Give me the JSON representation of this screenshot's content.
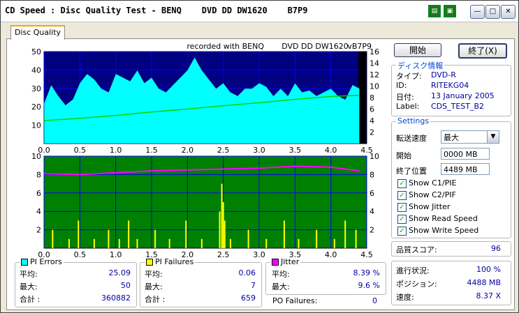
{
  "window": {
    "title": "CD Speed : Disc Quality Test - BENQ    DVD DD DW1620    B7P9",
    "icons": [
      "copy-icon",
      "save-icon"
    ]
  },
  "tab": {
    "label": "Disc Quality"
  },
  "chart_header": {
    "recorded": "recorded with BENQ",
    "drive": "DVD DD DW1620",
    "version": "vB7P9"
  },
  "buttons": {
    "start": "開始",
    "exit": "終了(X)"
  },
  "disc_info": {
    "title": "ディスク情報",
    "rows": [
      {
        "k": "タイプ:",
        "v": "DVD-R"
      },
      {
        "k": "ID:",
        "v": "RITEKG04"
      },
      {
        "k": "日付:",
        "v": "13 January 2005"
      },
      {
        "k": "Label:",
        "v": "CDS_TEST_B2"
      }
    ]
  },
  "settings": {
    "title": "Settings",
    "speed_label": "転送速度",
    "speed_value": "最大",
    "start_label": "開始",
    "start_value": "0000 MB",
    "end_label": "終了位置",
    "end_value": "4489 MB",
    "checks": [
      {
        "label": "Show C1/PIE",
        "checked": true
      },
      {
        "label": "Show C2/PIF",
        "checked": true
      },
      {
        "label": "Show Jitter",
        "checked": true
      },
      {
        "label": "Show Read Speed",
        "checked": true
      },
      {
        "label": "Show Write Speed",
        "checked": true
      }
    ]
  },
  "quality": {
    "label": "品質スコア:",
    "value": "96"
  },
  "progress": [
    {
      "k": "進行状況:",
      "v": "100 %"
    },
    {
      "k": "ポジション:",
      "v": "4488 MB"
    },
    {
      "k": "速度:",
      "v": "8.37 X"
    }
  ],
  "pi_errors": {
    "title": "PI Errors",
    "color": "#00ffff",
    "rows": [
      {
        "k": "平均:",
        "v": "25.09"
      },
      {
        "k": "最大:",
        "v": "50"
      },
      {
        "k": "合計 :",
        "v": "360882"
      }
    ]
  },
  "pi_failures": {
    "title": "PI Failures",
    "color": "#ffff00",
    "rows": [
      {
        "k": "平均:",
        "v": "0.06"
      },
      {
        "k": "最大:",
        "v": "7"
      },
      {
        "k": "合計 :",
        "v": "659"
      }
    ]
  },
  "jitter": {
    "title": "Jitter",
    "color": "#ff00ff",
    "rows": [
      {
        "k": "平均:",
        "v": "8.39 %"
      },
      {
        "k": "最大:",
        "v": "9.6 %"
      }
    ]
  },
  "po_failures": {
    "label": "PO Failures:",
    "value": "0"
  },
  "chart_data": [
    {
      "type": "area",
      "series": [
        {
          "name": "PI Errors",
          "color": "#00ffff",
          "x": [
            0,
            0.1,
            0.2,
            0.3,
            0.4,
            0.5,
            0.6,
            0.7,
            0.8,
            0.9,
            1.0,
            1.1,
            1.2,
            1.3,
            1.4,
            1.5,
            1.6,
            1.7,
            1.8,
            1.9,
            2.0,
            2.1,
            2.2,
            2.3,
            2.4,
            2.5,
            2.6,
            2.7,
            2.8,
            2.9,
            3.0,
            3.1,
            3.2,
            3.3,
            3.4,
            3.5,
            3.6,
            3.7,
            3.8,
            3.9,
            4.0,
            4.1,
            4.2,
            4.3,
            4.4
          ],
          "y": [
            22,
            32,
            26,
            21,
            24,
            33,
            38,
            35,
            30,
            28,
            38,
            36,
            34,
            40,
            33,
            36,
            30,
            28,
            32,
            36,
            40,
            47,
            40,
            35,
            30,
            33,
            28,
            26,
            30,
            30,
            33,
            31,
            26,
            30,
            26,
            33,
            28,
            29,
            26,
            28,
            30,
            26,
            24,
            32,
            30
          ]
        },
        {
          "name": "Read Speed",
          "color": "#00d000",
          "x": [
            0,
            0.5,
            1.0,
            1.5,
            2.0,
            2.5,
            3.0,
            3.5,
            4.0,
            4.4
          ],
          "y": [
            4,
            4.4,
            4.9,
            5.5,
            6.0,
            6.6,
            7.1,
            7.7,
            8.2,
            8.4
          ]
        }
      ],
      "xlim": [
        0,
        4.5
      ],
      "ylim": [
        0,
        50
      ],
      "y2lim": [
        0,
        16
      ],
      "xticks": [
        "0.0",
        "0.5",
        "1.0",
        "1.5",
        "2.0",
        "2.5",
        "3.0",
        "3.5",
        "4.0",
        "4.5"
      ],
      "yticks": [
        "10",
        "20",
        "30",
        "40",
        "50"
      ],
      "y2ticks": [
        "2",
        "4",
        "6",
        "8",
        "10",
        "12",
        "14",
        "16"
      ]
    },
    {
      "type": "bar",
      "series": [
        {
          "name": "PI Failures",
          "color": "#ffff00",
          "x": [
            0.12,
            0.35,
            0.48,
            0.7,
            0.9,
            1.05,
            1.18,
            1.3,
            1.55,
            1.75,
            1.98,
            2.2,
            2.45,
            2.48,
            2.5,
            2.52,
            2.6,
            2.85,
            3.1,
            3.35,
            3.55,
            3.8,
            4.05,
            4.2,
            4.35
          ],
          "y": [
            2,
            1,
            3,
            1,
            2,
            1,
            3,
            1,
            2,
            1,
            3,
            1,
            4,
            7,
            5,
            3,
            1,
            2,
            1,
            3,
            1,
            2,
            1,
            3,
            2
          ]
        },
        {
          "name": "Jitter",
          "color": "#ff00ff",
          "x": [
            0,
            0.5,
            1.0,
            1.5,
            2.0,
            2.5,
            3.0,
            3.5,
            4.0,
            4.4
          ],
          "y": [
            8.1,
            8.0,
            8.2,
            8.4,
            8.5,
            8.6,
            8.7,
            8.9,
            8.8,
            8.4
          ]
        }
      ],
      "xlim": [
        0,
        4.5
      ],
      "ylim": [
        0,
        10
      ],
      "xticks": [
        "0.0",
        "0.5",
        "1.0",
        "1.5",
        "2.0",
        "2.5",
        "3.0",
        "3.5",
        "4.0",
        "4.5"
      ],
      "yticks": [
        "2",
        "4",
        "6",
        "8",
        "10"
      ],
      "y2ticks": [
        "2",
        "4",
        "6",
        "8",
        "10"
      ]
    }
  ]
}
